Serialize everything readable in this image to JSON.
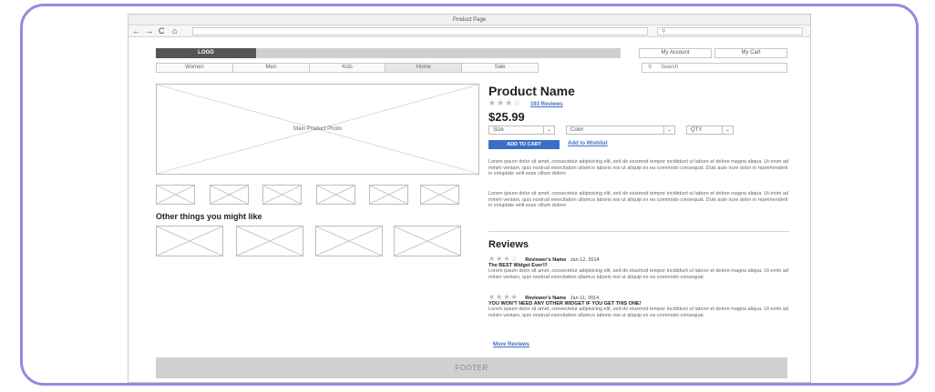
{
  "browser": {
    "title": "Product Page",
    "nav_icons": [
      "←",
      "→",
      "C",
      "⌂"
    ],
    "search_icon": "⚲"
  },
  "header": {
    "logo": "LOGO",
    "my_account": "My Account",
    "my_cart": "My Cart"
  },
  "nav": {
    "items": [
      "Women",
      "Men",
      "Kids",
      "Home",
      "Sale"
    ],
    "search_placeholder": "Search"
  },
  "gallery": {
    "main_photo_label": "Main Product Photo",
    "other_title": "Other things you might like"
  },
  "product": {
    "name": "Product Name",
    "stars": "★★★☆",
    "reviews_link": "193 Reviews",
    "price": "$25.99",
    "size_label": "Size",
    "color_label": "Color",
    "qty_label": "QTY",
    "add_to_cart": "ADD TO CART",
    "wishlist": "Add to Wishlist",
    "desc1": "Lorem ipsum dolor sit amet, consectetur adipisicing elit, sed do eiusmod tempor incididunt ut labore et dolore magna aliqua. Ut enim ad minim veniam, quis nostrud exercitation ullamco laboris nisi ut aliquip ex ea commodo consequat. Duis aute irure dolor in reprehenderit in voluptate velit esse cillum dolore",
    "desc2": "Lorem ipsum dolor sit amet, consectetur adipisicing elit, sed do eiusmod tempor incididunt ut labore et dolore magna aliqua. Ut enim ad minim veniam, quis nostrud exercitation ullamco laboris nisi ut aliquip ex ea commodo consequat. Duis aute irure dolor in reprehenderit in voluptate velit esse cillum dolore"
  },
  "reviews": {
    "title": "Reviews",
    "items": [
      {
        "stars": "★★★☆",
        "name": "Reviewer's Name",
        "date": "Jan 12, 2014",
        "headline": "The BEST Widget Ever!!!",
        "body": "Lorem ipsum dolor sit amet, consectetur adipisicing elit, sed do eiusmod tempor incididunt ut labore et dolore magna aliqua. Ut enim ad minim veniam, quis nostrud exercitation ullamco laboris nisi ut aliquip ex ea commodo consequat."
      },
      {
        "stars": "★★★★",
        "name": "Reviewer's Name",
        "date": "Jan 11, 2014",
        "headline": "YOU WON'T NEED ANY OTHER WIDGET IF YOU GET THIS ONE!",
        "body": "Lorem ipsum dolor sit amet, consectetur adipisicing elit, sed do eiusmod tempor incididunt ut labore et dolore magna aliqua. Ut enim ad minim veniam, quis nostrud exercitation ullamco laboris nisi ut aliquip ex ea commodo consequat."
      }
    ],
    "more": "More Reviews"
  },
  "footer": "FOOTER",
  "colors": {
    "accent": "#3b6fc7",
    "frame": "#9b87e0"
  }
}
